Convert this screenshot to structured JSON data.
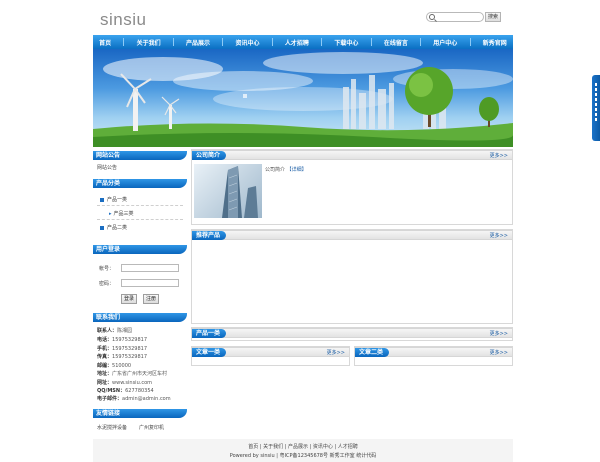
{
  "header": {
    "logo": "sinsiu",
    "search_button": "搜索"
  },
  "nav": [
    "首页",
    "关于我们",
    "产品展示",
    "资讯中心",
    "人才招聘",
    "下载中心",
    "在线留言",
    "用户中心",
    "新秀官网"
  ],
  "left": {
    "notice": {
      "title": "网站公告",
      "text": "网站公告"
    },
    "categories": {
      "title": "产品分类",
      "items": [
        "产品一类",
        "产品三类",
        "产品二类"
      ]
    },
    "login": {
      "title": "用户登录",
      "account_label": "帐号：",
      "password_label": "密码：",
      "login_button": "登录",
      "register_button": "注册"
    },
    "contact": {
      "title": "联系我们",
      "rows": [
        {
          "label": "联系人：",
          "value": "陈湘园"
        },
        {
          "label": "电话：",
          "value": "15975329817"
        },
        {
          "label": "手机：",
          "value": "15975329817"
        },
        {
          "label": "传真：",
          "value": "15975329817"
        },
        {
          "label": "邮编：",
          "value": "510000"
        },
        {
          "label": "地址：",
          "value": "广东省广州市天河区车村"
        },
        {
          "label": "网址：",
          "value": "www.sinsiu.com"
        },
        {
          "label": "QQ/MSN：",
          "value": "627780354"
        },
        {
          "label": "电子邮件：",
          "value": "admin@admin.com"
        }
      ]
    },
    "links": {
      "title": "友情链接",
      "items": [
        "水泥搅拌设备",
        "广州复印机"
      ]
    }
  },
  "main": {
    "about": {
      "title": "公司简介",
      "more": "更多>>",
      "text": "公司简介",
      "detail": "【详细】"
    },
    "recommend": {
      "title": "推荐产品",
      "more": "更多>>"
    },
    "product_one": {
      "title": "产品一类",
      "more": "更多>>"
    },
    "article_one": {
      "title": "文章一类",
      "more": "更多>>"
    },
    "article_two": {
      "title": "文章二类",
      "more": "更多>>"
    }
  },
  "footer": {
    "links": [
      "首页",
      "关于我们",
      "产品展示",
      "资讯中心",
      "人才招聘"
    ],
    "separator": "|",
    "powered_prefix": "Powered by",
    "powered_name": "sinsiu",
    "icp": "粤ICP备12345678号",
    "studio": "新秀工作室",
    "stats": "统计代码"
  },
  "colors": {
    "nav_blue": "#0a6fc2",
    "link_blue": "#1d5fa6"
  }
}
